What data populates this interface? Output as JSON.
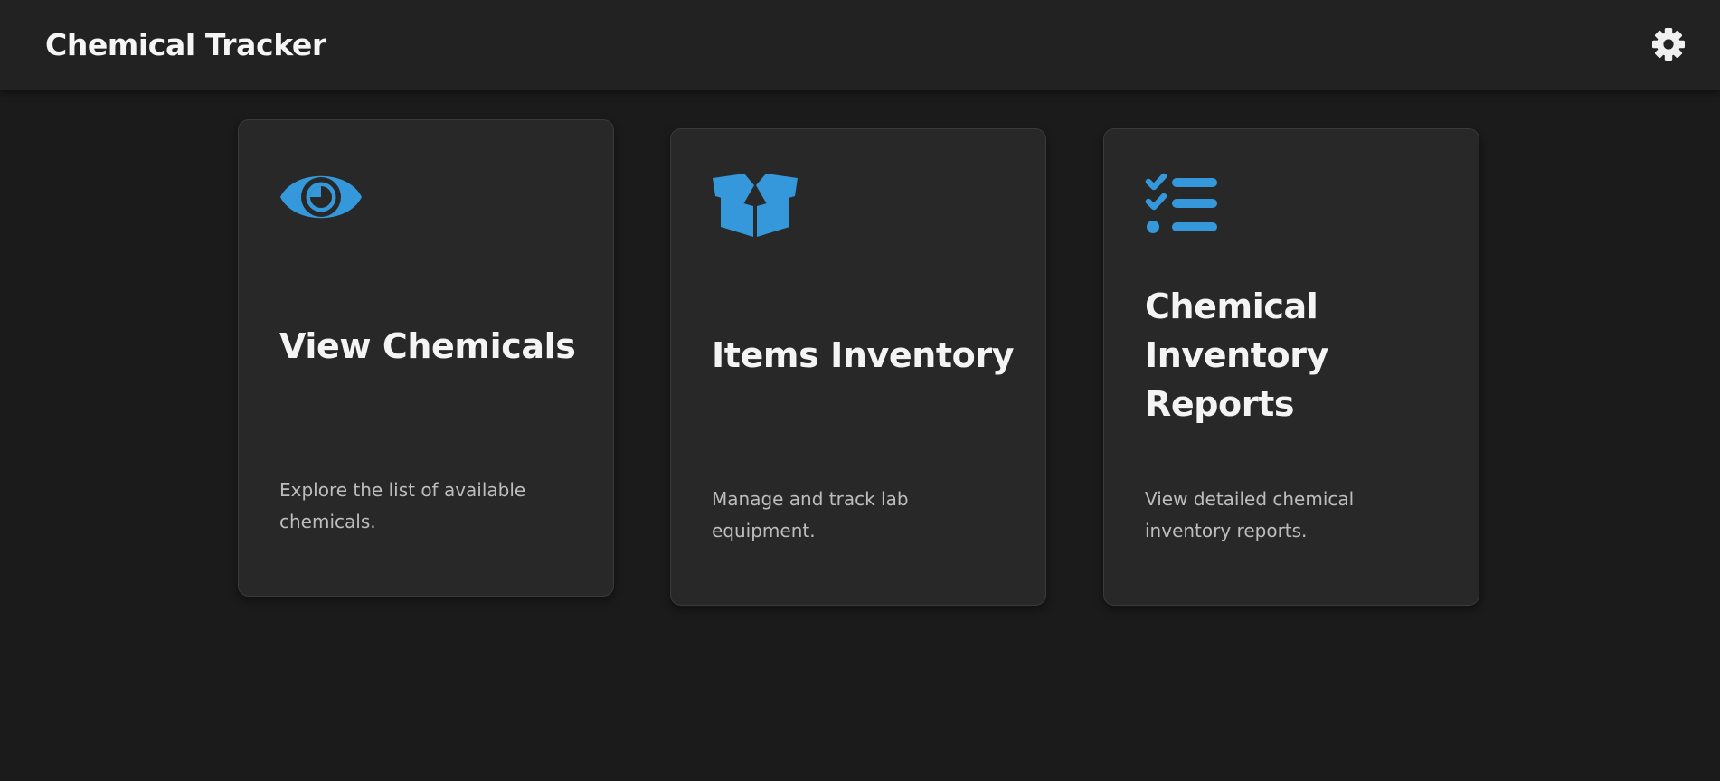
{
  "header": {
    "title": "Chemical Tracker",
    "settings_icon": "gear-icon"
  },
  "cards": [
    {
      "icon": "eye-icon",
      "title": "View Chemicals",
      "description": "Explore the list of available chemicals."
    },
    {
      "icon": "box-open-icon",
      "title": "Items Inventory",
      "description": "Manage and track lab equipment."
    },
    {
      "icon": "list-check-icon",
      "title": "Chemical Inventory Reports",
      "description": "View detailed chemical inventory reports."
    }
  ],
  "colors": {
    "accent": "#3498db",
    "background": "#1b1b1b",
    "header_background": "#222222",
    "card_background": "#282828",
    "title_text": "#f4f4f4",
    "description_text": "#bdbdbd"
  }
}
